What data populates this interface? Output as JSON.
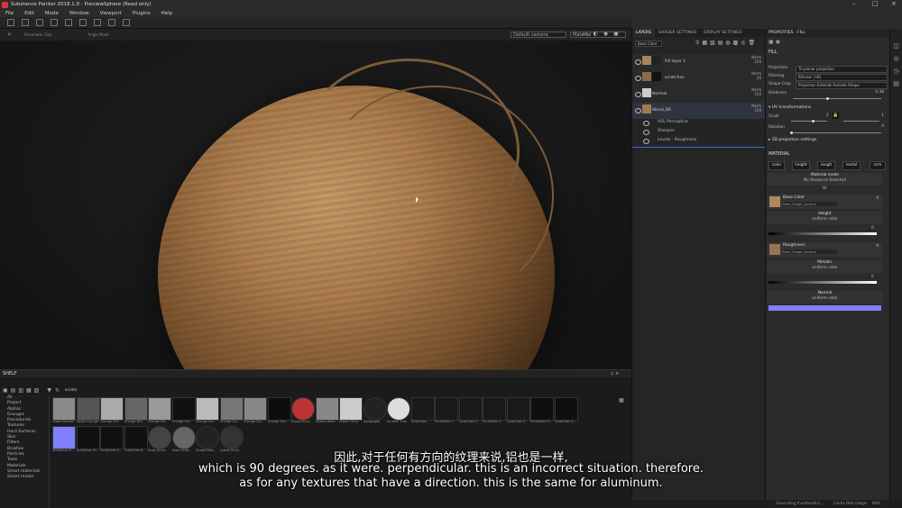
{
  "window": {
    "title": "Substance Painter 2018.1.0 - PreviewSphere (Read only)"
  },
  "menu": [
    "File",
    "Edit",
    "Mode",
    "Window",
    "Viewport",
    "Plugins",
    "Help"
  ],
  "toolbar": {
    "param1_label": "Parameter Size",
    "param2_label": "Angle Mode"
  },
  "viewport": {
    "camera_select": "Default camera",
    "mode_select": "Material"
  },
  "layers_panel": {
    "tabs": [
      "LAYERS",
      "SHADER SETTINGS",
      "DISPLAY SETTINGS"
    ],
    "channel_select": "Base Color",
    "layers": [
      {
        "name": "Fill layer 1",
        "blend": "Norm",
        "opacity": "100"
      },
      {
        "name": "scratches",
        "blend": "Norm",
        "opacity": "26"
      },
      {
        "name": "Normal",
        "blend": "Norm",
        "opacity": "100"
      },
      {
        "name": "Wood_BR",
        "blend": "Norm",
        "opacity": "100"
      }
    ],
    "effects": [
      "HSL Perceptive",
      "Sharpen",
      "Levels - Roughness"
    ]
  },
  "properties": {
    "title": "PROPERTIES - FILL",
    "section_fill": "FILL",
    "projection_label": "Projection",
    "projection_value": "Tri-planar projection",
    "filtering_label": "Filtering",
    "filtering_value": "Bilinear | HQ",
    "shape_crop_label": "Shape Crop",
    "shape_crop_value": "Projection Extends Outside Shape",
    "hardness_label": "Hardness",
    "hardness_value": "0.38",
    "uv_section": "UV transformations",
    "scale_label": "Scale",
    "scale_value": "2",
    "scale_value2": "1",
    "rotation_label": "Rotation",
    "rotation_value": "0",
    "proj3d_section": "3D projection settings",
    "material_section": "MATERIAL",
    "channels": [
      "color",
      "height",
      "rough",
      "metal",
      "nrm"
    ],
    "material_mode": "Material mode",
    "no_resource": "No Resource Selected",
    "or": "Or",
    "base_color_title": "Base Color",
    "base_color_src": "New_Graph_output",
    "height_title": "Height",
    "height_sub": "uniform color",
    "height_value": "0",
    "roughness_title": "Roughness",
    "roughness_src": "New_Graph_output",
    "metallic_title": "Metallic",
    "metallic_sub": "uniform color",
    "metallic_value": "0",
    "normal_title": "Normal",
    "normal_sub": "uniform color"
  },
  "shelf": {
    "title": "SHELF",
    "search": "scratc",
    "categories": [
      "All",
      "Project",
      "Alphas",
      "Grunges",
      "Procedurals",
      "Textures",
      "Hard Surfaces",
      "Skin",
      "Filters",
      "Brushes",
      "Particles",
      "Tools",
      "Materials",
      "Smart materials",
      "Smart masks"
    ],
    "row1": [
      "Grass Normal",
      "Stripe Grunge",
      "Grunge Dirt",
      "Grunge Dirt",
      "Grunge Pai..",
      "Grunge Scr..",
      "Grunge Scr..",
      "Grunge Scr..",
      "Grunge Scr..",
      "Grunge Scr..",
      "Stains Scra..",
      "Hexes Label..",
      "Plastic Dirty..",
      "Sandpaper",
      "Scratch Thin",
      "Scratches",
      "Scratches 2",
      "Scratches 3",
      "Scratches 4",
      "Scratches 5",
      "Scratches D..",
      "Scratches G.."
    ],
    "row2": [
      "Scratches El..",
      "Scratches Hi..",
      "Scratches S..",
      "Scratches S..",
      "Stain Scrat..",
      "Steel Scrat..",
      "Shape Dam..",
      "Subtle Scrat.."
    ]
  },
  "subtitles": {
    "line_cn": "因此,对于任何有方向的纹理来说,铝也是一样,",
    "line1": "which is 90 degrees. as it were. perpendicular. this is an incorrect situation. therefore.",
    "line2": "as for any textures that have a direction. this is the same for aluminum."
  },
  "status": {
    "generating": "Generating thumbnail(s)...",
    "cache": "Cache Disk Usage:",
    "cache_value": "84%"
  },
  "colors": {
    "accent_blue": "#7f7fff",
    "orange": "#e08a2a"
  }
}
